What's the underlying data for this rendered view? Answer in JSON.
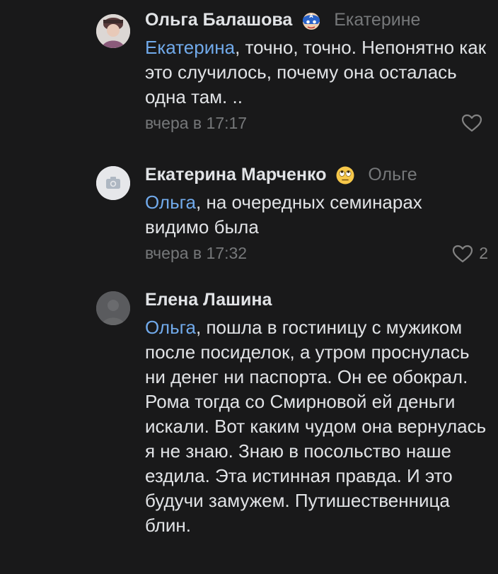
{
  "comments": [
    {
      "author": "Ольга Балашова",
      "badge_icon": "captain-mask-icon",
      "reply_to": "Екатерине",
      "mention": "Екатерина",
      "text": ", точно, точно. Непонятно как это случилось, почему она осталась одна там. ..",
      "time": "вчера в 17:17",
      "likes": ""
    },
    {
      "author": "Екатерина Марченко",
      "badge_icon": "eye-roll-emoji-icon",
      "reply_to": "Ольге",
      "mention": "Ольга",
      "text": ", на очередных семинарах видимо была",
      "time": "вчера в 17:32",
      "likes": "2"
    },
    {
      "author": "Елена Лашина",
      "mention": "Ольга",
      "text": ", пошла в гостиницу с мужиком после посиделок, а утром проснулась ни денег ни паспорта. Он ее обокрал. Рома тогда со Смирновой ей деньги искали. Вот каким чудом она вернулась я не знаю. Знаю в посольство наше ездила. Эта истинная правда. И это будучи замужем. Путишественница блин."
    }
  ],
  "colors": {
    "background": "#19191a",
    "text": "#e1e3e6",
    "secondary": "#76787a",
    "mention": "#71aaeb"
  }
}
